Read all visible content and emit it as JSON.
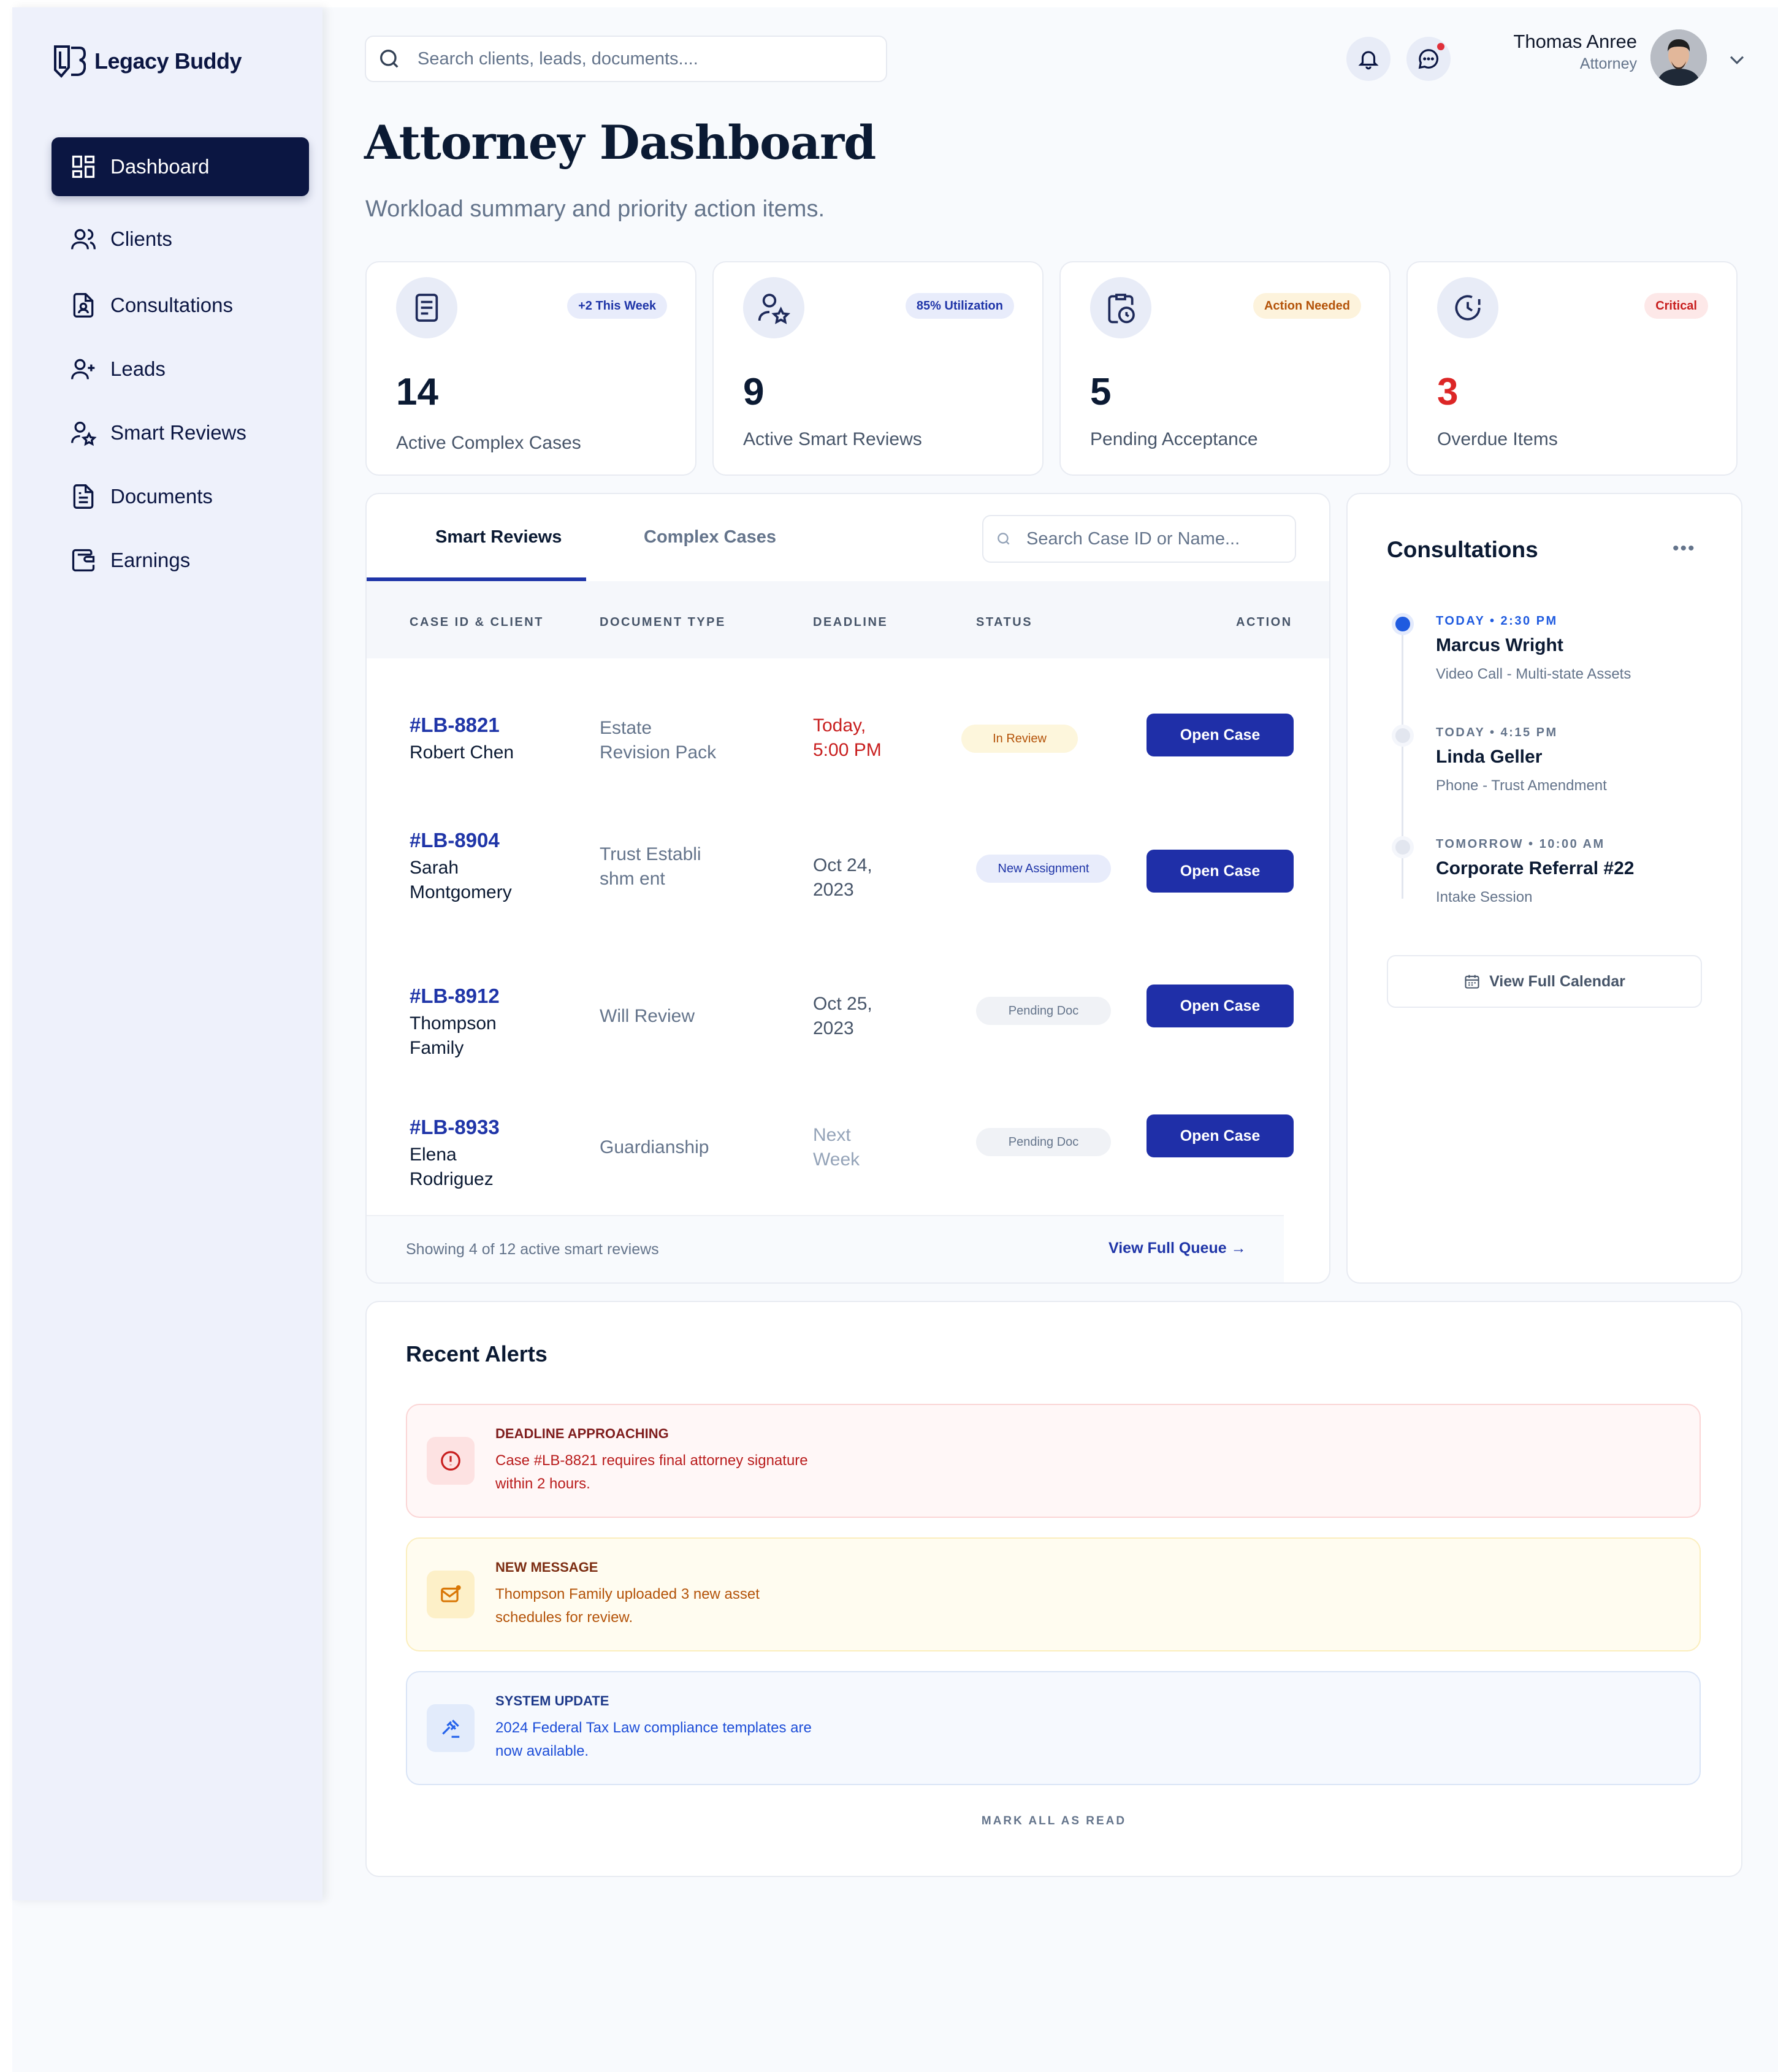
{
  "app": {
    "name": "Legacy Buddy"
  },
  "sidebar": {
    "items": [
      {
        "label": "Dashboard",
        "icon": "dashboard-icon",
        "active": true
      },
      {
        "label": "Clients",
        "icon": "users-icon"
      },
      {
        "label": "Consultations",
        "icon": "consultation-icon"
      },
      {
        "label": "Leads",
        "icon": "user-plus-icon"
      },
      {
        "label": "Smart Reviews",
        "icon": "user-star-icon"
      },
      {
        "label": "Documents",
        "icon": "document-icon"
      },
      {
        "label": "Earnings",
        "icon": "wallet-icon"
      }
    ]
  },
  "header": {
    "search_placeholder": "Search clients, leads, documents....",
    "user_name": "Thomas Anree",
    "user_role": "Attorney",
    "page_title": "Attorney Dashboard",
    "page_subtitle": "Workload summary and priority action items."
  },
  "stats": [
    {
      "value": "14",
      "label": "Active Complex Cases",
      "badge": "+2 This Week",
      "icon": "book-icon"
    },
    {
      "value": "9",
      "label": "Active Smart Reviews",
      "badge": "85% Utilization",
      "icon": "user-star-icon"
    },
    {
      "value": "5",
      "label": "Pending Acceptance",
      "badge": "Action Needed",
      "icon": "clipboard-clock-icon"
    },
    {
      "value": "3",
      "label": "Overdue Items",
      "badge": "Critical",
      "icon": "clock-alert-icon"
    }
  ],
  "reviews": {
    "tabs": [
      "Smart Reviews",
      "Complex Cases"
    ],
    "search_placeholder": "Search Case ID or Name...",
    "columns": [
      "CASE ID & CLIENT",
      "DOCUMENT TYPE",
      "DEADLINE",
      "STATUS",
      "ACTION"
    ],
    "rows": [
      {
        "case_id": "#LB-8821",
        "client": "Robert Chen",
        "doc_type": "Estate Revision Pack",
        "deadline": "Today, 5:00 PM",
        "status": "In Review",
        "action": "Open Case"
      },
      {
        "case_id": "#LB-8904",
        "client": "Sarah Montgomery",
        "doc_type": "Trust Establishm ent",
        "deadline": "Oct 24, 2023",
        "status": "New Assignment",
        "action": "Open Case"
      },
      {
        "case_id": "#LB-8912",
        "client": "Thompson Family",
        "doc_type": "Will Review",
        "deadline": "Oct 25, 2023",
        "status": "Pending Doc",
        "action": "Open Case"
      },
      {
        "case_id": "#LB-8933",
        "client": "Elena Rodriguez",
        "doc_type": "Guardianship",
        "deadline": "Next Week",
        "status": "Pending Doc",
        "action": "Open Case"
      }
    ],
    "footer_text": "Showing 4 of 12 active smart reviews",
    "footer_link": "View Full Queue →"
  },
  "consultations": {
    "title": "Consultations",
    "more": "•••",
    "items": [
      {
        "time": "TODAY • 2:30 PM",
        "name": "Marcus Wright",
        "desc": "Video Call - Multi-state Assets"
      },
      {
        "time": "TODAY • 4:15 PM",
        "name": "Linda Geller",
        "desc": "Phone - Trust Amendment"
      },
      {
        "time": "TOMORROW • 10:00 AM",
        "name": "Corporate Referral #22",
        "desc": "Intake Session"
      }
    ],
    "calendar_button": "View Full Calendar"
  },
  "alerts": {
    "title": "Recent Alerts",
    "items": [
      {
        "title": "DEADLINE APPROACHING",
        "body": "Case #LB-8821 requires final attorney signature within 2 hours.",
        "icon": "alert-circle-icon"
      },
      {
        "title": "NEW MESSAGE",
        "body": "Thompson Family uploaded 3 new asset schedules for review.",
        "icon": "mail-icon"
      },
      {
        "title": "SYSTEM UPDATE",
        "body": "2024 Federal Tax Law compliance templates are now available.",
        "icon": "gavel-icon"
      }
    ],
    "mark_all": "MARK ALL AS READ"
  },
  "colors": {
    "brand_navy": "#0b1642",
    "primary_blue": "#1f2fa8",
    "critical_red": "#dc2626",
    "deadline_red": "#c81e1e"
  }
}
